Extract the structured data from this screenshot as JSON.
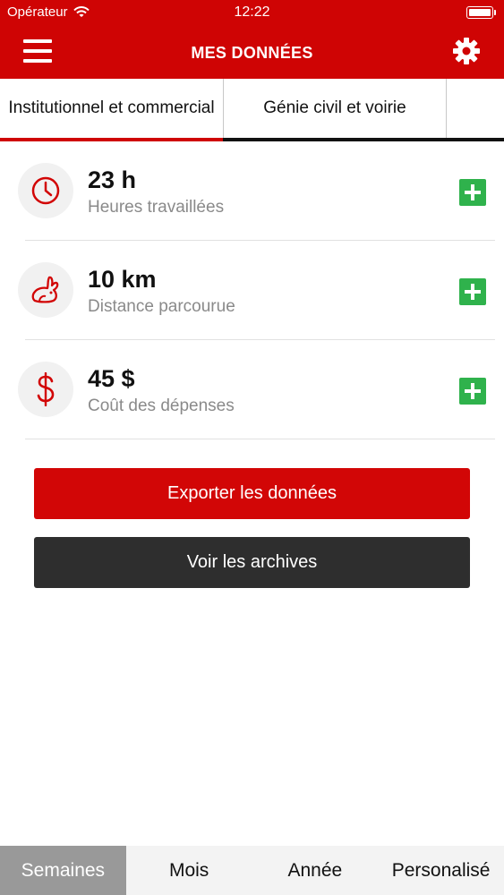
{
  "status_bar": {
    "carrier": "Opérateur",
    "time": "12:22"
  },
  "nav": {
    "title": "MES DONNÉES",
    "menu_icon": "hamburger-icon",
    "settings_icon": "gear-icon"
  },
  "tabs": [
    {
      "label": "Institutionnel et commercial",
      "active": true
    },
    {
      "label": "Génie civil et voirie",
      "active": false
    },
    {
      "label": "",
      "active": false
    }
  ],
  "stats": [
    {
      "value": "23 h",
      "label": "Heures travaillées",
      "icon": "clock-icon"
    },
    {
      "value": "10 km",
      "label": "Distance parcourue",
      "icon": "rabbit-icon"
    },
    {
      "value": "45 $",
      "label": "Coût des dépenses",
      "icon": "dollar-icon"
    }
  ],
  "buttons": {
    "export": "Exporter les données",
    "archives": "Voir les archives"
  },
  "periods": [
    {
      "label": "Semaines",
      "active": true
    },
    {
      "label": "Mois",
      "active": false
    },
    {
      "label": "Année",
      "active": false
    },
    {
      "label": "Personalisé",
      "active": false
    }
  ],
  "colors": {
    "brand_red": "#cf0404",
    "add_green": "#2fb24c",
    "dark_button": "#2e2e2e",
    "active_period": "#999999"
  }
}
